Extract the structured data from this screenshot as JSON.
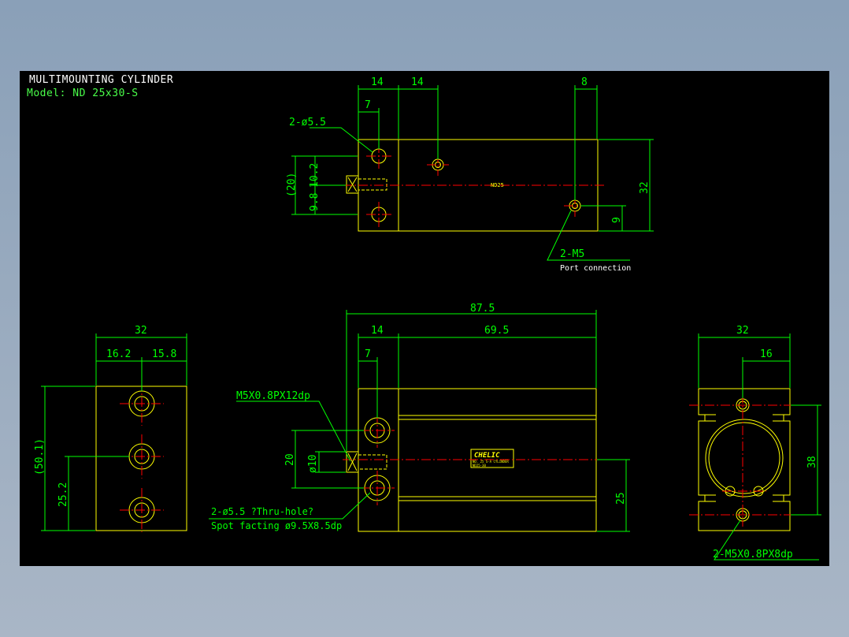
{
  "title": "MULTIMOUNTING CYLINDER",
  "model": "Model:  ND 25x30-S",
  "colors": {
    "outline": "#ffff00",
    "dim": "#00ff00",
    "center": "#ff0000",
    "background": "#000000"
  },
  "top_view": {
    "dims": {
      "d14a": "14",
      "d14b": "14",
      "d8": "8",
      "d7": "7",
      "d10_2": "10.2",
      "d9_8": "9.8",
      "d20": "(20)",
      "d32": "32",
      "d9": "9"
    },
    "notes": {
      "holes": "2-ø5.5",
      "port": "2-M5",
      "port_desc": "Port connection",
      "label": "ND25"
    }
  },
  "front_view": {
    "dims": {
      "d87_5": "87.5",
      "d14": "14",
      "d69_5": "69.5",
      "d7": "7",
      "d20": "20",
      "d10": "ø10",
      "d25": "25"
    },
    "notes": {
      "thread": "M5X0.8PX12dp",
      "holes": "2-ø5.5 ?Thru-hole?",
      "spot": "Spot facting  ø9.5X8.5dp",
      "brand": "CHELIC",
      "brand_sub1": "NO. 25  S-A  CYLINDER",
      "brand_sub2": "ND25-30"
    }
  },
  "left_view": {
    "dims": {
      "d32": "32",
      "d16_2": "16.2",
      "d15_8": "15.8",
      "d50_1": "(50.1)",
      "d25_2": "25.2"
    }
  },
  "right_view": {
    "dims": {
      "d32": "32",
      "d16": "16",
      "d38": "38"
    },
    "notes": {
      "thread": "2-M5X0.8PX8dp"
    }
  }
}
